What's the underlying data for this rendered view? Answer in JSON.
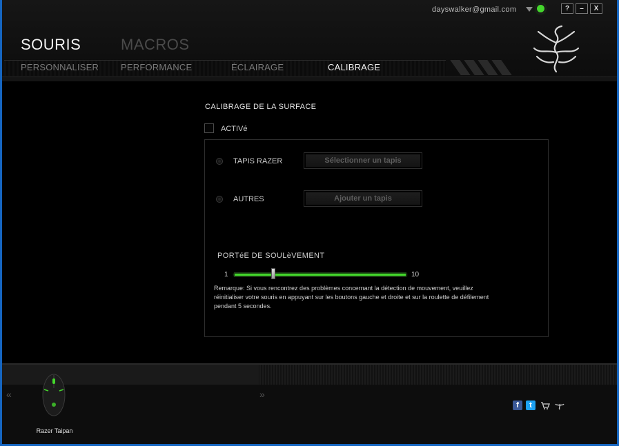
{
  "window": {
    "email": "dayswalker@gmail.com",
    "help_label": "?",
    "minimize_label": "–",
    "close_label": "X"
  },
  "main_tabs": [
    {
      "label": "SOURIS",
      "active": true
    },
    {
      "label": "MACROS",
      "active": false
    }
  ],
  "sub_tabs": [
    {
      "label": "PERSONNALISER",
      "active": false
    },
    {
      "label": "PERFORMANCE",
      "active": false
    },
    {
      "label": "ÉCLAIRAGE",
      "active": false
    },
    {
      "label": "CALIBRAGE",
      "active": true
    }
  ],
  "calibration": {
    "title": "CALIBRAGE DE LA SURFACE",
    "enabled_label": "ACTIVé",
    "enabled": false,
    "razer_label": "TAPIS RAZER",
    "razer_button": "Sélectionner un tapis",
    "others_label": "AUTRES",
    "others_button": "Ajouter un tapis",
    "lift_title": "PORTéE DE SOULèVEMENT",
    "slider_min": "1",
    "slider_max": "10",
    "slider_value": 3,
    "remark": "Remarque: Si vous rencontrez des problèmes concernant la détection de mouvement, veuillez réinitialiser votre souris en appuyant sur les boutons gauche et droite et sur la roulette de défilement pendant 5 secondes."
  },
  "footer": {
    "prev_label": "«",
    "next_label": "»",
    "device_name": "Razer Taipan",
    "icons": [
      "facebook-icon",
      "twitter-icon",
      "cart-icon",
      "razer-icon"
    ]
  },
  "colors": {
    "accent_green": "#44d62c",
    "edge_blue": "#1565c0"
  }
}
